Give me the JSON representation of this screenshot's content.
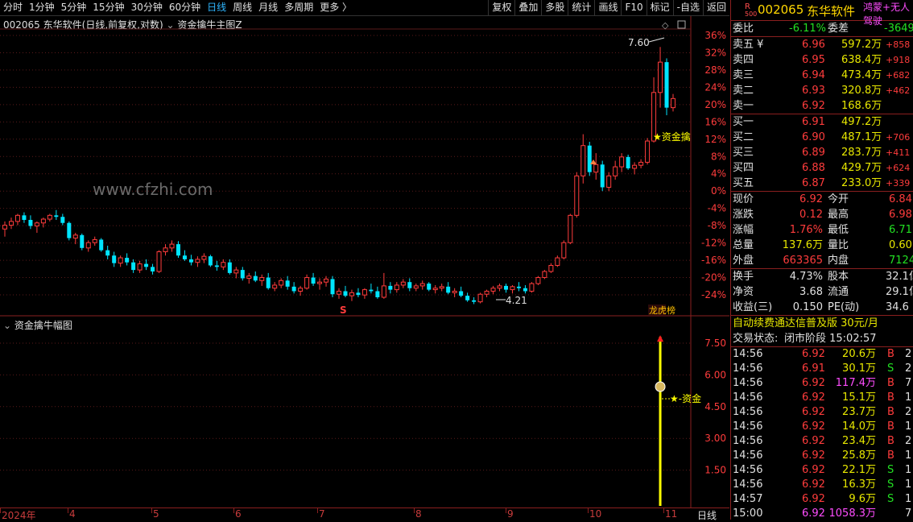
{
  "toolbar": {
    "left": [
      "分时",
      "1分钟",
      "5分钟",
      "15分钟",
      "30分钟",
      "60分钟",
      "日线",
      "周线",
      "月线",
      "多周期",
      "更多 〉"
    ],
    "active": "日线",
    "right": [
      "复权",
      "叠加",
      "多股",
      "统计",
      "画线",
      "F10",
      "标记",
      "-自选",
      "返回"
    ]
  },
  "main_chart": {
    "code": "002065",
    "title": "东华软件(日线,前复权,对数)",
    "indicator": "资金擒牛主图Z",
    "watermark": "www.cfzhi.com",
    "high_label": "7.60",
    "low_label": "4.21",
    "signal_text": "★资金擒",
    "marker_s": "S",
    "marker_rank": "龙虎榜"
  },
  "price_axis": [
    "36%",
    "32%",
    "28%",
    "24%",
    "20%",
    "16%",
    "12%",
    "8%",
    "4%",
    "0%",
    "-4%",
    "-8%",
    "-12%",
    "-16%",
    "-20%",
    "-24%"
  ],
  "sub_chart": {
    "title": "资金擒牛幅图",
    "axis": [
      "7.50",
      "6.00",
      "4.50",
      "3.00",
      "1.50"
    ],
    "signal_text": "★-资金"
  },
  "x_axis": {
    "labels": [
      "2024年",
      "4",
      "5",
      "6",
      "7",
      "8",
      "9",
      "10",
      "11"
    ],
    "period": "日线"
  },
  "chart_data": {
    "type": "candlestick",
    "ohlc": [
      [
        5.2,
        5.3,
        5.1,
        5.25
      ],
      [
        5.25,
        5.35,
        5.2,
        5.3
      ],
      [
        5.3,
        5.4,
        5.25,
        5.38
      ],
      [
        5.38,
        5.42,
        5.28,
        5.32
      ],
      [
        5.32,
        5.38,
        5.2,
        5.24
      ],
      [
        5.24,
        5.3,
        5.15,
        5.28
      ],
      [
        5.28,
        5.35,
        5.22,
        5.33
      ],
      [
        5.33,
        5.4,
        5.3,
        5.38
      ],
      [
        5.38,
        5.45,
        5.32,
        5.36
      ],
      [
        5.36,
        5.4,
        5.25,
        5.28
      ],
      [
        5.28,
        5.3,
        5.05,
        5.08
      ],
      [
        5.08,
        5.15,
        5.0,
        5.12
      ],
      [
        5.12,
        5.14,
        4.92,
        4.95
      ],
      [
        4.95,
        5.05,
        4.9,
        5.02
      ],
      [
        5.02,
        5.1,
        4.98,
        5.06
      ],
      [
        5.06,
        5.08,
        4.9,
        4.92
      ],
      [
        4.92,
        4.98,
        4.8,
        4.85
      ],
      [
        4.85,
        4.9,
        4.7,
        4.75
      ],
      [
        4.75,
        4.85,
        4.7,
        4.82
      ],
      [
        4.82,
        4.88,
        4.72,
        4.76
      ],
      [
        4.76,
        4.8,
        4.62,
        4.66
      ],
      [
        4.66,
        4.78,
        4.62,
        4.74
      ],
      [
        4.74,
        4.8,
        4.66,
        4.7
      ],
      [
        4.7,
        4.74,
        4.6,
        4.64
      ],
      [
        4.64,
        4.92,
        4.62,
        4.9
      ],
      [
        4.9,
        5.0,
        4.85,
        4.95
      ],
      [
        4.95,
        5.05,
        4.9,
        5.0
      ],
      [
        5.0,
        5.04,
        4.82,
        4.85
      ],
      [
        4.85,
        4.92,
        4.78,
        4.8
      ],
      [
        4.8,
        4.86,
        4.72,
        4.76
      ],
      [
        4.76,
        4.84,
        4.7,
        4.8
      ],
      [
        4.8,
        4.88,
        4.75,
        4.84
      ],
      [
        4.84,
        4.86,
        4.7,
        4.72
      ],
      [
        4.72,
        4.78,
        4.65,
        4.7
      ],
      [
        4.7,
        4.8,
        4.66,
        4.76
      ],
      [
        4.76,
        4.8,
        4.6,
        4.62
      ],
      [
        4.62,
        4.7,
        4.55,
        4.66
      ],
      [
        4.66,
        4.7,
        4.52,
        4.55
      ],
      [
        4.55,
        4.62,
        4.48,
        4.58
      ],
      [
        4.58,
        4.64,
        4.5,
        4.52
      ],
      [
        4.52,
        4.6,
        4.45,
        4.56
      ],
      [
        4.56,
        4.62,
        4.4,
        4.42
      ],
      [
        4.42,
        4.5,
        4.38,
        4.46
      ],
      [
        4.46,
        4.55,
        4.42,
        4.52
      ],
      [
        4.52,
        4.58,
        4.4,
        4.44
      ],
      [
        4.44,
        4.5,
        4.35,
        4.38
      ],
      [
        4.38,
        4.45,
        4.32,
        4.42
      ],
      [
        4.42,
        4.6,
        4.4,
        4.56
      ],
      [
        4.56,
        4.62,
        4.45,
        4.48
      ],
      [
        4.48,
        4.55,
        4.4,
        4.5
      ],
      [
        4.5,
        4.58,
        4.44,
        4.54
      ],
      [
        4.54,
        4.58,
        4.3,
        4.34
      ],
      [
        4.34,
        4.42,
        4.28,
        4.38
      ],
      [
        4.38,
        4.45,
        4.3,
        4.32
      ],
      [
        4.32,
        4.4,
        4.25,
        4.36
      ],
      [
        4.36,
        4.42,
        4.3,
        4.33
      ],
      [
        4.33,
        4.42,
        4.28,
        4.4
      ],
      [
        4.4,
        4.48,
        4.35,
        4.38
      ],
      [
        4.38,
        4.44,
        4.28,
        4.3
      ],
      [
        4.3,
        4.62,
        4.28,
        4.45
      ],
      [
        4.45,
        4.5,
        4.35,
        4.4
      ],
      [
        4.4,
        4.5,
        4.36,
        4.46
      ],
      [
        4.46,
        4.54,
        4.42,
        4.5
      ],
      [
        4.5,
        4.55,
        4.38,
        4.42
      ],
      [
        4.42,
        4.48,
        4.38,
        4.45
      ],
      [
        4.45,
        4.52,
        4.4,
        4.48
      ],
      [
        4.48,
        4.5,
        4.38,
        4.4
      ],
      [
        4.4,
        4.46,
        4.35,
        4.42
      ],
      [
        4.42,
        4.48,
        4.38,
        4.44
      ],
      [
        4.44,
        4.5,
        4.34,
        4.36
      ],
      [
        4.36,
        4.42,
        4.3,
        4.38
      ],
      [
        4.38,
        4.44,
        4.3,
        4.32
      ],
      [
        4.32,
        4.36,
        4.24,
        4.26
      ],
      [
        4.26,
        4.3,
        4.21,
        4.24
      ],
      [
        4.24,
        4.36,
        4.22,
        4.34
      ],
      [
        4.34,
        4.4,
        4.3,
        4.38
      ],
      [
        4.38,
        4.45,
        4.34,
        4.42
      ],
      [
        4.42,
        4.48,
        4.38,
        4.45
      ],
      [
        4.45,
        4.48,
        4.36,
        4.4
      ],
      [
        4.4,
        4.46,
        4.35,
        4.44
      ],
      [
        4.44,
        4.5,
        4.38,
        4.42
      ],
      [
        4.42,
        4.46,
        4.35,
        4.38
      ],
      [
        4.38,
        4.5,
        4.36,
        4.48
      ],
      [
        4.48,
        4.58,
        4.46,
        4.56
      ],
      [
        4.56,
        4.66,
        4.54,
        4.64
      ],
      [
        4.64,
        4.75,
        4.62,
        4.72
      ],
      [
        4.72,
        4.85,
        4.7,
        4.82
      ],
      [
        4.82,
        5.05,
        4.8,
        5.02
      ],
      [
        5.02,
        5.4,
        5.0,
        5.38
      ],
      [
        5.38,
        5.95,
        5.35,
        5.9
      ],
      [
        5.9,
        6.45,
        5.8,
        6.3
      ],
      [
        6.3,
        6.35,
        5.9,
        5.95
      ],
      [
        5.95,
        6.2,
        5.85,
        6.05
      ],
      [
        6.05,
        6.1,
        5.7,
        5.75
      ],
      [
        5.75,
        5.95,
        5.7,
        5.9
      ],
      [
        5.9,
        6.1,
        5.85,
        6.02
      ],
      [
        6.02,
        6.2,
        5.95,
        6.15
      ],
      [
        6.15,
        6.18,
        5.98,
        6.0
      ],
      [
        6.0,
        6.08,
        5.92,
        6.04
      ],
      [
        6.04,
        6.12,
        6.0,
        6.08
      ],
      [
        6.08,
        6.4,
        6.05,
        6.36
      ],
      [
        6.36,
        7.2,
        6.34,
        7.0
      ],
      [
        7.0,
        7.6,
        6.8,
        7.4
      ],
      [
        7.4,
        7.45,
        6.7,
        6.8
      ],
      [
        6.8,
        6.98,
        6.75,
        6.92
      ]
    ],
    "sub_signal": {
      "value": 7.8,
      "label": "★-资金"
    }
  },
  "quote": {
    "code": "002065",
    "name": "东华软件",
    "badge": "R",
    "badge_sub": "500",
    "tags": "鸿蒙+无人驾驶",
    "weibi_label": "委比",
    "weibi": "-6.11%",
    "weicha_label": "委差",
    "weicha": "-3649",
    "sells": [
      {
        "label": "卖五 ¥",
        "price": "6.96",
        "vol": "597.2万",
        "chg": "+858"
      },
      {
        "label": "卖四",
        "price": "6.95",
        "vol": "638.4万",
        "chg": "+918"
      },
      {
        "label": "卖三",
        "price": "6.94",
        "vol": "473.4万",
        "chg": "+682"
      },
      {
        "label": "卖二",
        "price": "6.93",
        "vol": "320.8万",
        "chg": "+462"
      },
      {
        "label": "卖一",
        "price": "6.92",
        "vol": "168.6万",
        "chg": ""
      }
    ],
    "buys": [
      {
        "label": "买一",
        "price": "6.91",
        "vol": "497.2万",
        "chg": ""
      },
      {
        "label": "买二",
        "price": "6.90",
        "vol": "487.1万",
        "chg": "+706"
      },
      {
        "label": "买三",
        "price": "6.89",
        "vol": "283.7万",
        "chg": "+411"
      },
      {
        "label": "买四",
        "price": "6.88",
        "vol": "429.7万",
        "chg": "+624"
      },
      {
        "label": "买五",
        "price": "6.87",
        "vol": "233.0万",
        "chg": "+339"
      }
    ],
    "stats": [
      {
        "l1": "现价",
        "v1": "6.92",
        "c1": "red",
        "l2": "今开",
        "v2": "6.84",
        "c2": "red"
      },
      {
        "l1": "涨跌",
        "v1": "0.12",
        "c1": "red",
        "l2": "最高",
        "v2": "6.98",
        "c2": "red"
      },
      {
        "l1": "涨幅",
        "v1": "1.76%",
        "c1": "red",
        "l2": "最低",
        "v2": "6.71",
        "c2": "green"
      },
      {
        "l1": "总量",
        "v1": "137.6万",
        "c1": "yel",
        "l2": "量比",
        "v2": "0.60",
        "c2": "yel"
      },
      {
        "l1": "外盘",
        "v1": "663365",
        "c1": "red",
        "l2": "内盘",
        "v2": "712470",
        "c2": "green"
      }
    ],
    "stats2": [
      {
        "l1": "换手",
        "v1": "4.73%",
        "l2": "股本",
        "v2": "32.1亿"
      },
      {
        "l1": "净资",
        "v1": "3.68",
        "l2": "流通",
        "v2": "29.1亿"
      },
      {
        "l1": "收益(三)",
        "v1": "0.150",
        "l2": "PE(动)",
        "v2": "34.6"
      }
    ],
    "promo": "自动续费通达信普及版  30元/月",
    "status_label": "交易状态:",
    "status": "闭市阶段 15:02:57",
    "ticks": [
      {
        "t": "14:56",
        "p": "6.92",
        "v": "20.6万",
        "bs": "B",
        "n": "2"
      },
      {
        "t": "14:56",
        "p": "6.91",
        "v": "30.1万",
        "bs": "S",
        "n": "2"
      },
      {
        "t": "14:56",
        "p": "6.92",
        "v": "117.4万",
        "bs": "B",
        "n": "7"
      },
      {
        "t": "14:56",
        "p": "6.92",
        "v": "15.1万",
        "bs": "B",
        "n": "1"
      },
      {
        "t": "14:56",
        "p": "6.92",
        "v": "23.7万",
        "bs": "B",
        "n": "2"
      },
      {
        "t": "14:56",
        "p": "6.92",
        "v": "14.0万",
        "bs": "B",
        "n": "1"
      },
      {
        "t": "14:56",
        "p": "6.92",
        "v": "23.4万",
        "bs": "B",
        "n": "2"
      },
      {
        "t": "14:56",
        "p": "6.92",
        "v": "25.8万",
        "bs": "B",
        "n": "1"
      },
      {
        "t": "14:56",
        "p": "6.92",
        "v": "22.1万",
        "bs": "S",
        "n": "1"
      },
      {
        "t": "14:56",
        "p": "6.92",
        "v": "16.3万",
        "bs": "S",
        "n": "1"
      },
      {
        "t": "14:57",
        "p": "6.92",
        "v": "9.6万",
        "bs": "S",
        "n": "1"
      },
      {
        "t": "15:00",
        "p": "6.92",
        "v": "1058.3万",
        "bs": "",
        "n": "7"
      }
    ]
  }
}
